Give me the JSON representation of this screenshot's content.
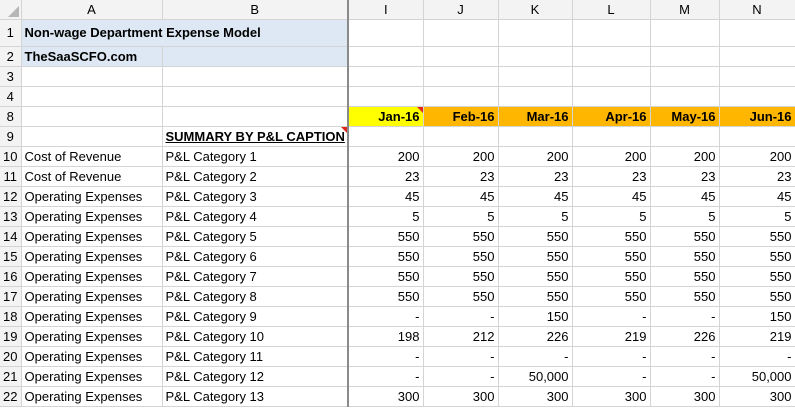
{
  "columns": [
    "A",
    "B",
    "I",
    "J",
    "K",
    "L",
    "M",
    "N"
  ],
  "title": "Non-wage Department Expense Model",
  "site": "TheSaaSCFO.com",
  "row_numbers": {
    "r1": "1",
    "r2": "2",
    "r3": "3",
    "r4": "4",
    "r8": "8",
    "r9": "9"
  },
  "months": [
    "Jan-16",
    "Feb-16",
    "Mar-16",
    "Apr-16",
    "May-16",
    "Jun-16"
  ],
  "summary_label": "SUMMARY BY P&L CAPTION",
  "rows": [
    {
      "num": "10",
      "a": "Cost of Revenue",
      "b": "P&L Category 1",
      "v": [
        "200",
        "200",
        "200",
        "200",
        "200",
        "200"
      ]
    },
    {
      "num": "11",
      "a": "Cost of Revenue",
      "b": "P&L Category 2",
      "v": [
        "23",
        "23",
        "23",
        "23",
        "23",
        "23"
      ]
    },
    {
      "num": "12",
      "a": "Operating Expenses",
      "b": "P&L Category 3",
      "v": [
        "45",
        "45",
        "45",
        "45",
        "45",
        "45"
      ]
    },
    {
      "num": "13",
      "a": "Operating Expenses",
      "b": "P&L Category 4",
      "v": [
        "5",
        "5",
        "5",
        "5",
        "5",
        "5"
      ]
    },
    {
      "num": "14",
      "a": "Operating Expenses",
      "b": "P&L Category 5",
      "v": [
        "550",
        "550",
        "550",
        "550",
        "550",
        "550"
      ]
    },
    {
      "num": "15",
      "a": "Operating Expenses",
      "b": "P&L Category 6",
      "v": [
        "550",
        "550",
        "550",
        "550",
        "550",
        "550"
      ]
    },
    {
      "num": "16",
      "a": "Operating Expenses",
      "b": "P&L Category 7",
      "v": [
        "550",
        "550",
        "550",
        "550",
        "550",
        "550"
      ]
    },
    {
      "num": "17",
      "a": "Operating Expenses",
      "b": "P&L Category 8",
      "v": [
        "550",
        "550",
        "550",
        "550",
        "550",
        "550"
      ]
    },
    {
      "num": "18",
      "a": "Operating Expenses",
      "b": "P&L Category 9",
      "v": [
        "-",
        "-",
        "150",
        "-",
        "-",
        "150"
      ]
    },
    {
      "num": "19",
      "a": "Operating Expenses",
      "b": "P&L Category 10",
      "v": [
        "198",
        "212",
        "226",
        "219",
        "226",
        "219"
      ]
    },
    {
      "num": "20",
      "a": "Operating Expenses",
      "b": "P&L Category 11",
      "v": [
        "-",
        "-",
        "-",
        "-",
        "-",
        "-"
      ]
    },
    {
      "num": "21",
      "a": "Operating Expenses",
      "b": "P&L Category 12",
      "v": [
        "-",
        "-",
        "50,000",
        "-",
        "-",
        "50,000"
      ]
    },
    {
      "num": "22",
      "a": "Operating Expenses",
      "b": "P&L Category 13",
      "v": [
        "300",
        "300",
        "300",
        "300",
        "300",
        "300"
      ]
    }
  ],
  "colors": {
    "header_yellow": "#ffff00",
    "header_orange": "#ffb600",
    "title_fill": "#dde8f4",
    "comment_marker": "#e0281c"
  }
}
